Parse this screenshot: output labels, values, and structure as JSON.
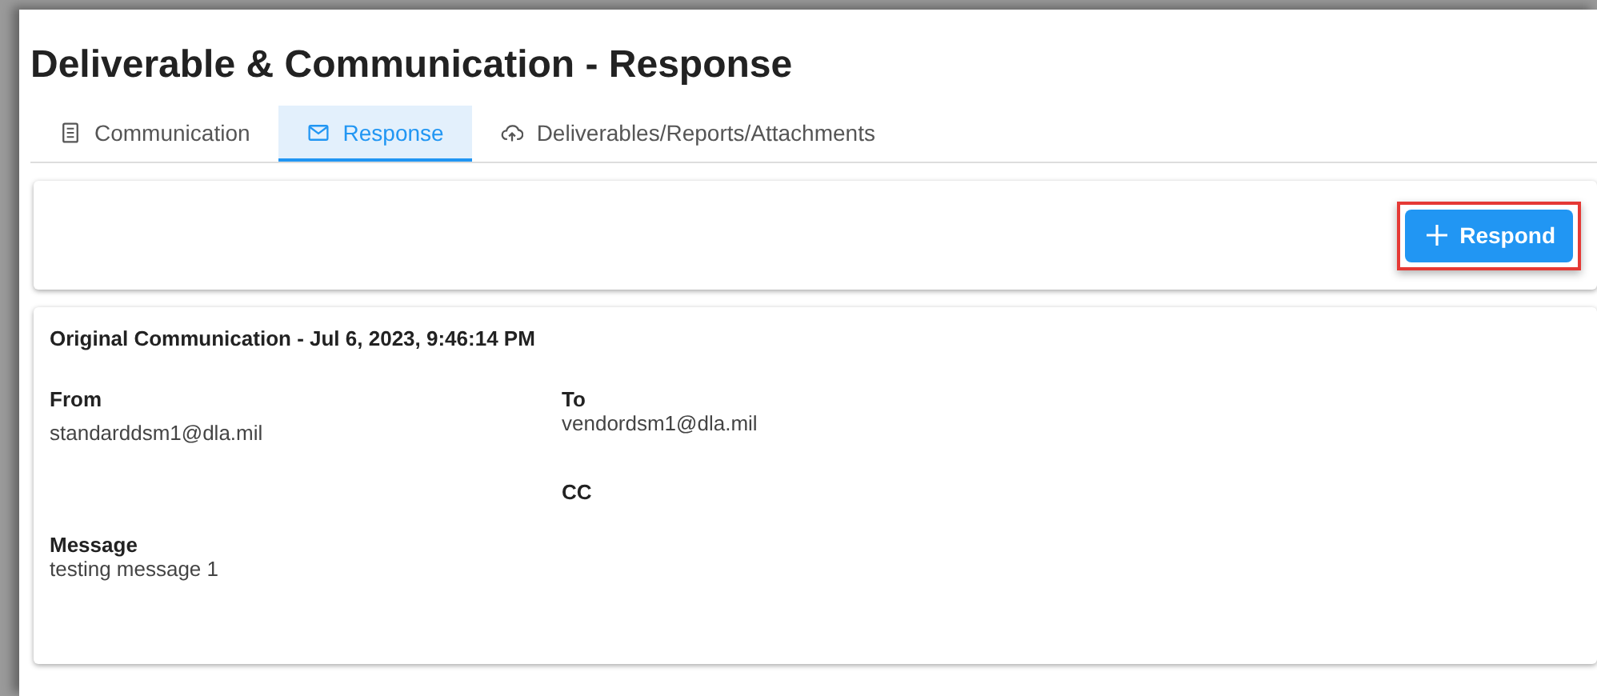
{
  "page": {
    "title": "Deliverable & Communication - Response"
  },
  "tabs": [
    {
      "label": "Communication",
      "selected": false
    },
    {
      "label": "Response",
      "selected": true
    },
    {
      "label": "Deliverables/Reports/Attachments",
      "selected": false
    }
  ],
  "toolbar": {
    "respond_button": {
      "label": "Respond",
      "highlighted": true
    }
  },
  "communication": {
    "heading": "Original Communication - Jul 6, 2023, 9:46:14 PM",
    "fields": [
      {
        "label": "From",
        "value": "standarddsm1@dla.mil"
      },
      {
        "label": "To",
        "value": "vendordsm1@dla.mil"
      },
      {
        "label": "CC"
      },
      {
        "label": "Message",
        "value": "testing message 1"
      }
    ]
  }
}
